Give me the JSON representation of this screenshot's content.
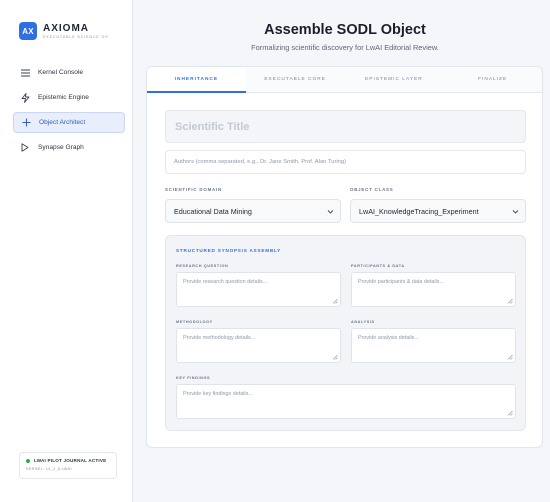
{
  "brand": {
    "badge": "AX",
    "name": "AXIOMA",
    "subtitle": "EXECUTABLE SCIENCE OS"
  },
  "sidebar": {
    "items": [
      {
        "label": "Kernel Console",
        "icon": "menu-icon",
        "active": false
      },
      {
        "label": "Epistemic Engine",
        "icon": "bolt-icon",
        "active": false
      },
      {
        "label": "Object Architect",
        "icon": "plus-icon",
        "active": true
      },
      {
        "label": "Synapse Graph",
        "icon": "play-icon",
        "active": false
      }
    ],
    "status": {
      "title": "LWAI PILOT JOURNAL ACTIVE",
      "sub": "KERNEL: 14_2_8-LWAI",
      "color": "#22b14c"
    }
  },
  "header": {
    "title": "Assemble SODL Object",
    "subtitle": "Formalizing scientific discovery for LwAI Editorial Review."
  },
  "tabs": [
    {
      "label": "INHERITANCE",
      "active": true
    },
    {
      "label": "EXECUTABLE CORE",
      "active": false
    },
    {
      "label": "EPISTEMIC LAYER",
      "active": false
    },
    {
      "label": "FINALIZE",
      "active": false
    }
  ],
  "form": {
    "title_placeholder": "Scientific Title",
    "authors_placeholder": "Authors (comma separated, e.g., Dr. Jane Smith, Prof. Alan Turing)",
    "domain_label": "SCIENTIFIC DOMAIN",
    "domain_value": "Educational Data Mining",
    "class_label": "OBJECT CLASS",
    "class_value": "LwAI_KnowledgeTracing_Experiment"
  },
  "synopsis": {
    "title": "STRUCTURED SYNOPSIS ASSEMBLY",
    "fields": {
      "research_question": {
        "label": "RESEARCH QUESTION",
        "placeholder": "Provide research question details..."
      },
      "participants": {
        "label": "PARTICIPANTS & DATA",
        "placeholder": "Provide participants & data details..."
      },
      "methodology": {
        "label": "METHODOLOGY",
        "placeholder": "Provide methodology details..."
      },
      "analysis": {
        "label": "ANALYSIS",
        "placeholder": "Provide analysis details..."
      },
      "key_findings": {
        "label": "KEY FINDINGS",
        "placeholder": "Provide key findings details..."
      }
    }
  },
  "colors": {
    "accent": "#2f6fe4",
    "active_nav_bg": "#e8eefb"
  }
}
